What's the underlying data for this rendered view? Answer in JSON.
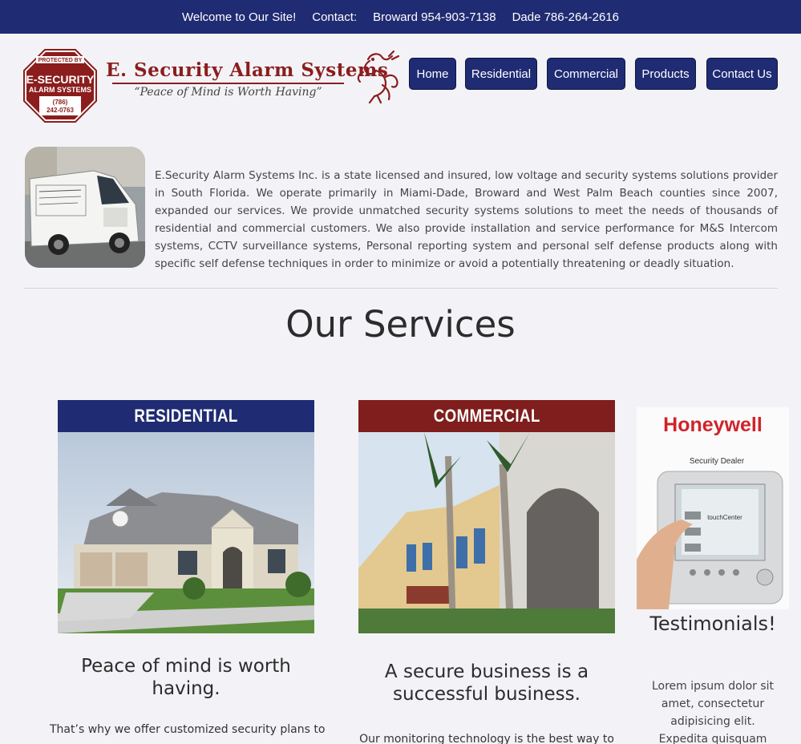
{
  "topbar": {
    "welcome": "Welcome to Our Site!",
    "contact_label": "Contact:",
    "broward": "Broward 954-903-7138",
    "dade": "Dade 786-264-2616"
  },
  "logo": {
    "sign_line1": "PROTECTED BY",
    "sign_line2": "E-SECURITY",
    "sign_line3": "ALARM SYSTEMS",
    "sign_line4": "(786)",
    "sign_line5": "242-0763",
    "brand_name": "E. Security Alarm Systems",
    "tagline": "“Peace of Mind is Worth Having”"
  },
  "nav": {
    "items": [
      {
        "label": "Home"
      },
      {
        "label": "Residential"
      },
      {
        "label": "Commercial"
      },
      {
        "label": "Products"
      },
      {
        "label": "Contact Us"
      }
    ]
  },
  "intro": {
    "text": "E.Security Alarm Systems Inc. is a state licensed and insured, low voltage and security systems solutions provider in South Florida. We operate primarily in Miami-Dade, Broward and West Palm Beach counties since 2007, expanded our services. We provide unmatched security systems solutions to meet the needs of thousands of residential and commercial customers. We also provide installation and service performance for M&S Intercom systems, CCTV surveillance systems, Personal reporting system and personal self defense products along with specific self defense techniques in order to minimize or avoid a potentially threatening or deadly situation."
  },
  "services": {
    "title": "Our Services",
    "residential": {
      "heading": "RESIDENTIAL",
      "subtitle": "Peace of mind is worth having.",
      "text": "That’s why we offer customized security plans to"
    },
    "commercial": {
      "heading": "COMMERCIAL",
      "subtitle": "A secure business is a successful business.",
      "text": "Our monitoring technology is the best way to"
    },
    "testimonials": {
      "brand": "Honeywell",
      "badge": "Security Dealer",
      "panel_label": "touchCenter",
      "title": "Testimonials!",
      "text": "Lorem ipsum dolor sit amet, consectetur adipisicing elit. Expedita quisquam modi alias."
    }
  },
  "colors": {
    "navy": "#1f2b72",
    "maroon": "#8b1d1d",
    "commercial_red": "#7f1e1c"
  }
}
